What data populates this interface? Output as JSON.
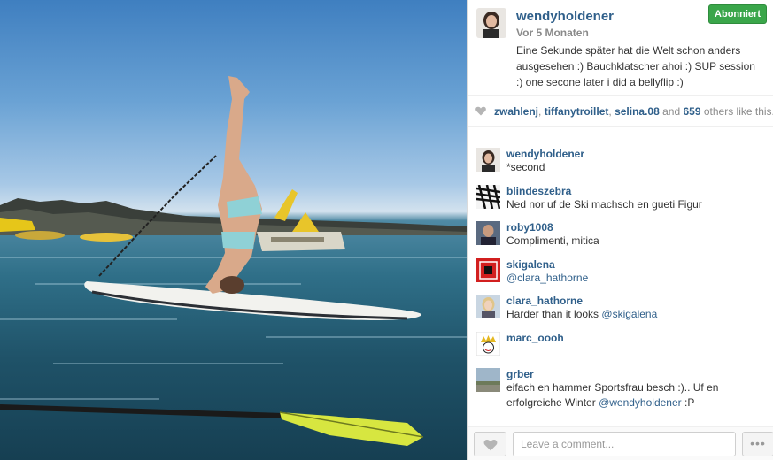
{
  "post": {
    "username": "wendyholdener",
    "time": "Vor 5 Monaten",
    "caption": "Eine Sekunde später hat die Welt schon anders ausgesehen :) Bauchklatscher ahoi :) SUP session :) one secone later i did a bellyflip :)",
    "follow_label": "Abonniert"
  },
  "likes": {
    "users": [
      "zwahlenj",
      "tiffanytroillet",
      "selina.08"
    ],
    "separator": ",",
    "and_label": "and",
    "count": "659",
    "suffix": "others like this."
  },
  "comments": [
    {
      "user": "wendyholdener",
      "text": "*second",
      "mention": "",
      "avatar": "portrait"
    },
    {
      "user": "blindeszebra",
      "text": "Ned nor uf de Ski machsch en gueti Figur",
      "mention": "",
      "avatar": "zebra"
    },
    {
      "user": "roby1008",
      "text": "Complimenti, mitica ",
      "mention": "",
      "avatar": "portrait-dark"
    },
    {
      "user": "skigalena",
      "text": "",
      "mention": "@clara_hathorne",
      "avatar": "red"
    },
    {
      "user": "clara_hathorne",
      "text": "Harder than it looks ",
      "mention": "@skigalena",
      "avatar": "portrait-light"
    },
    {
      "user": "marc_oooh",
      "text": "",
      "mention": "",
      "avatar": "crown"
    },
    {
      "user": "grber",
      "text": "eifach en hammer Sportsfrau besch :).. Uf en erfolgreiche Winter",
      "mention": "@wendyholdener",
      "suffix": ":P",
      "avatar": "landscape"
    }
  ],
  "footer": {
    "comment_placeholder": "Leave a comment...",
    "more_label": "•••"
  },
  "colors": {
    "link": "#2f5f8a",
    "follow_button": "#3aa64a"
  },
  "icons": [
    "heart-icon",
    "more-icon"
  ]
}
